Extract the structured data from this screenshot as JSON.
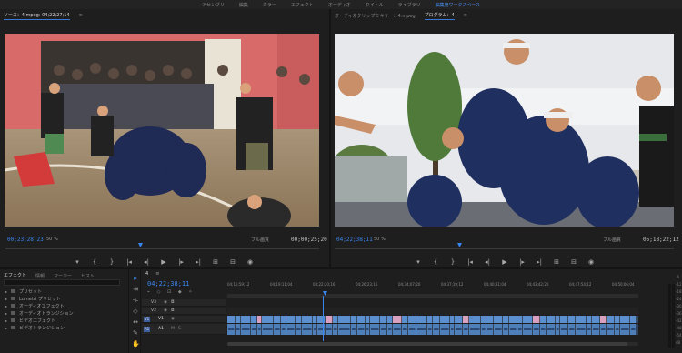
{
  "workspaces": [
    "アセンブリ",
    "編集",
    "カラー",
    "エフェクト",
    "オーディオ",
    "タイトル",
    "ライブラリ",
    "編集用ワークスペース"
  ],
  "active_workspace_index": 7,
  "source_monitor": {
    "tab_label": "ソース：4.mpeg: 04;22;27;14",
    "menu_icon": "≡",
    "timecode_left": "00;23;28;23",
    "zoom": "50 %",
    "resolution": "フル画質",
    "timecode_right": "00;00;25;20"
  },
  "program_monitor": {
    "tabs": [
      "オーディオクリップミキサー：4.mpeg",
      "プログラム：4"
    ],
    "active_tab_index": 1,
    "menu_icon": "≡",
    "timecode_left": "04;22;38;11",
    "zoom": "50 %",
    "resolution": "フル画質",
    "timecode_right": "05;18;22;12"
  },
  "transport_icons": [
    "marker-icon",
    "in-point-icon",
    "out-point-icon",
    "go-to-in-icon",
    "step-back-icon",
    "play-icon",
    "step-forward-icon",
    "go-to-out-icon",
    "insert-icon",
    "overwrite-icon",
    "export-frame-icon"
  ],
  "transport_glyphs": [
    "▾",
    "{",
    "}",
    "|◂",
    "◂|",
    "▶",
    "|▸",
    "▸|",
    "⊞",
    "⊟",
    "◉"
  ],
  "project_panel": {
    "tabs": [
      "エフェクト",
      "情報",
      "マーカー",
      "ヒスト"
    ],
    "active_tab_index": 0,
    "items": [
      "プリセット",
      "Lumetri プリセット",
      "オーディオエフェクト",
      "オーディオトランジション",
      "ビデオエフェクト",
      "ビデオトランジション"
    ]
  },
  "timeline": {
    "tabs": [
      "4"
    ],
    "timecode": "04;22;38;11",
    "ruler_labels": [
      "04;15;59;12",
      "04;19;11;04",
      "04;22;20;16",
      "04;26;23;16",
      "04;34;07;20",
      "04;37;19;12",
      "04;40;31;04",
      "04;43;42;20",
      "04;47;54;12",
      "04;50;06;04"
    ],
    "video_tracks": [
      "V3",
      "V2",
      "V1"
    ],
    "audio_tracks": [
      "A1"
    ]
  },
  "meters": {
    "labels": [
      "-6",
      "-12",
      "-18",
      "-24",
      "-30",
      "-36",
      "-42",
      "-48",
      "-54",
      "dB"
    ]
  },
  "colors": {
    "accent_blue": "#3a86f0",
    "clip_blue": "#5b8fcf",
    "clip_audio": "#4f7fb8",
    "panel_bg": "#1e1e1e"
  }
}
